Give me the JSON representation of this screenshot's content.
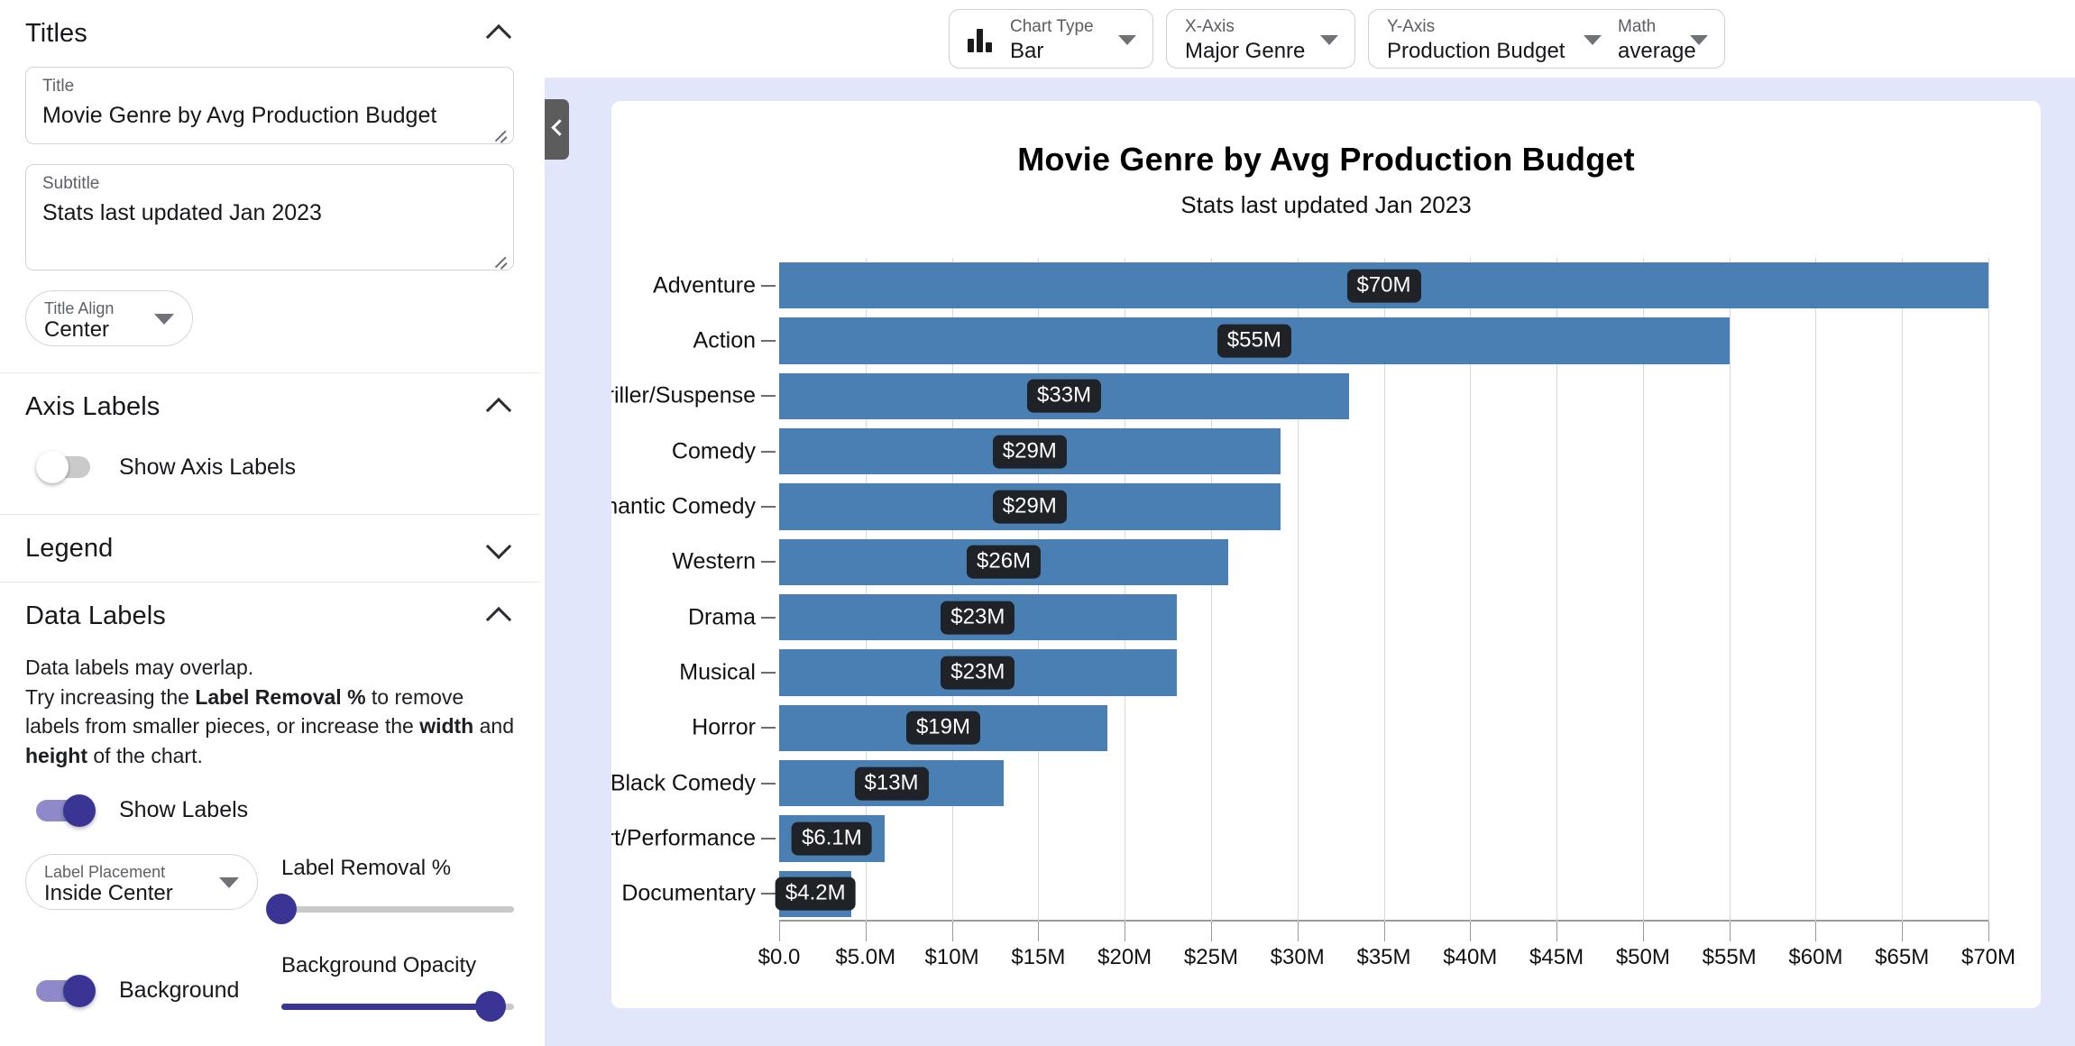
{
  "sidebar": {
    "sections": [
      {
        "id": "titles",
        "title": "Titles",
        "chevron": "chevron-up",
        "title_field": {
          "label": "Title",
          "value": "Movie Genre by Avg Production Budget"
        },
        "subtitle_field": {
          "label": "Subtitle",
          "value": "Stats last updated Jan 2023"
        },
        "title_align": {
          "label": "Title Align",
          "value": "Center"
        }
      },
      {
        "id": "axis-labels",
        "title": "Axis Labels",
        "chevron": "chevron-up",
        "show_axis_labels": {
          "label": "Show Axis Labels",
          "on": false
        }
      },
      {
        "id": "legend",
        "title": "Legend",
        "chevron": "chevron-down"
      },
      {
        "id": "data-labels",
        "title": "Data Labels",
        "chevron": "chevron-up",
        "helper_line1": "Data labels may overlap.",
        "helper_line2_a": "Try increasing the ",
        "helper_line2_b": "Label Removal %",
        "helper_line2_c": " to remove labels from smaller pieces, or increase the ",
        "helper_line2_d": "width",
        "helper_line2_e": " and ",
        "helper_line2_f": "height",
        "helper_line2_g": " of the chart.",
        "show_labels": {
          "label": "Show Labels",
          "on": true
        },
        "label_placement": {
          "label": "Label Placement",
          "value": "Inside Center"
        },
        "label_removal": {
          "label": "Label Removal %",
          "value": 0
        },
        "background_toggle": {
          "label": "Background",
          "on": true
        },
        "background_opacity": {
          "label": "Background Opacity",
          "value": 90
        }
      }
    ]
  },
  "collapse_handle": {
    "icon": "chevron-left-icon"
  },
  "toolbar": {
    "chart_type": {
      "label": "Chart Type",
      "value": "Bar",
      "icon": "bar-chart-icon"
    },
    "x_axis": {
      "label": "X-Axis",
      "value": "Major Genre"
    },
    "y_axis": {
      "label": "Y-Axis",
      "value": "Production Budget"
    },
    "math": {
      "label": "Math",
      "value": "average"
    }
  },
  "chart_data": {
    "type": "bar",
    "orientation": "horizontal",
    "title": "Movie Genre by Avg Production Budget",
    "subtitle": "Stats last updated Jan 2023",
    "xlabel": "",
    "ylabel": "",
    "grid": true,
    "legend": false,
    "xlim": [
      0,
      70
    ],
    "categories": [
      "Adventure",
      "Action",
      "Thriller/Suspense",
      "Comedy",
      "Romantic Comedy",
      "Western",
      "Drama",
      "Musical",
      "Horror",
      "Black Comedy",
      "Concert/Performance",
      "Documentary"
    ],
    "values": [
      70,
      55,
      33,
      29,
      29,
      26,
      23,
      23,
      19,
      13,
      6.1,
      4.2
    ],
    "data_labels": [
      "$70M",
      "$55M",
      "$33M",
      "$29M",
      "$29M",
      "$26M",
      "$23M",
      "$23M",
      "$19M",
      "$13M",
      "$6.1M",
      "$4.2M"
    ],
    "xticks": [
      0,
      5,
      10,
      15,
      20,
      25,
      30,
      35,
      40,
      45,
      50,
      55,
      60,
      65,
      70
    ],
    "xtick_labels": [
      "$0.0",
      "$5.0M",
      "$10M",
      "$15M",
      "$20M",
      "$25M",
      "$30M",
      "$35M",
      "$40M",
      "$45M",
      "$50M",
      "$55M",
      "$60M",
      "$65M",
      "$70M"
    ],
    "bar_color": "#4a7fb3",
    "label_bg_color": "#1f2328",
    "label_text_color": "#ffffff"
  },
  "theme": {
    "canvas_bg": "#e2e6fa",
    "accent": "#3a3595",
    "accent_light": "#8e8ac9"
  }
}
